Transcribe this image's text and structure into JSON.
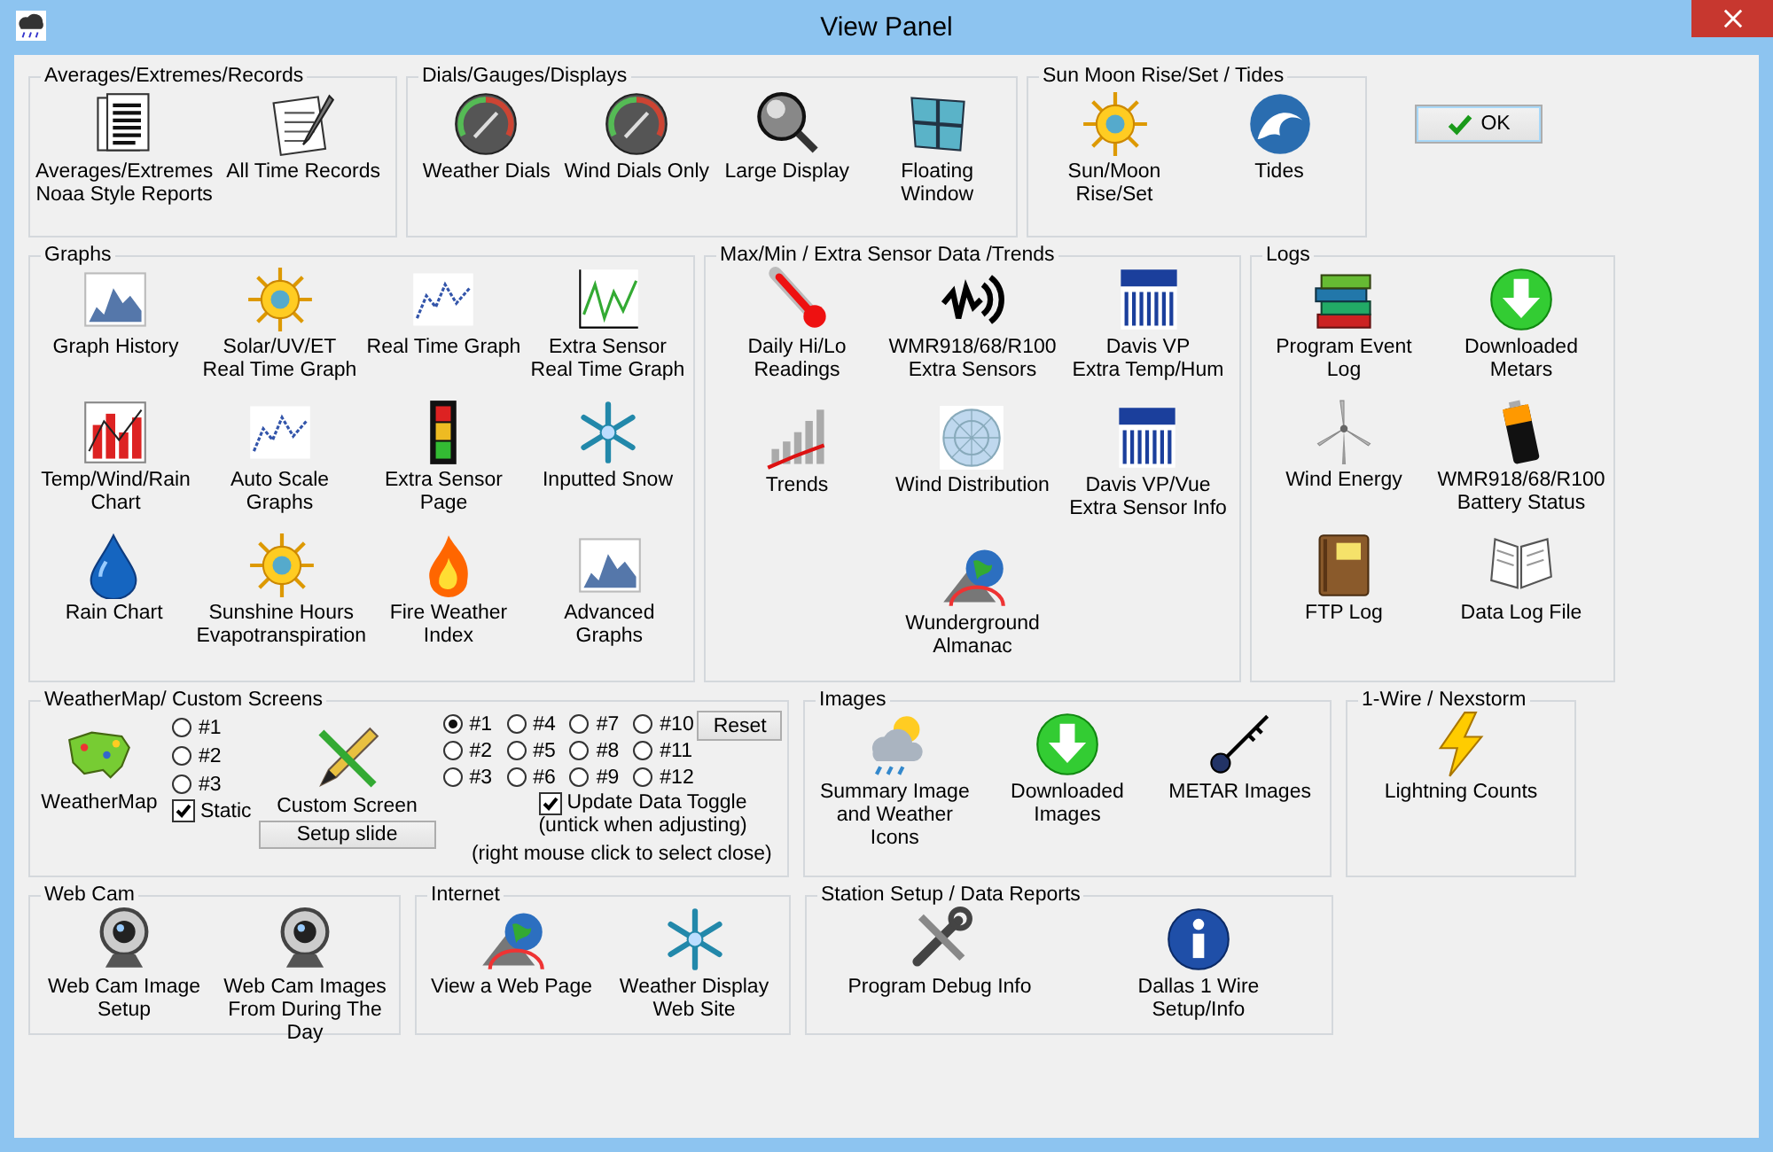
{
  "window": {
    "title": "View Panel"
  },
  "groups": [
    {
      "kind": "launchers",
      "title": "Averages/Extremes/Records",
      "rows": [
        [
          {
            "label": "Averages/Extremes\nNoaa Style Reports"
          },
          {
            "label": "All Time Records"
          }
        ]
      ]
    },
    {
      "kind": "launchers",
      "title": "Dials/Gauges/Displays",
      "rows": [
        [
          {
            "label": "Weather Dials"
          },
          {
            "label": "Wind Dials Only"
          },
          {
            "label": "Large Display"
          },
          {
            "label": "Floating Window"
          }
        ]
      ]
    },
    {
      "kind": "launchers",
      "title": "Sun Moon Rise/Set / Tides",
      "rows": [
        [
          {
            "label": "Sun/Moon\nRise/Set"
          },
          {
            "label": "Tides"
          }
        ]
      ]
    },
    {
      "kind": "launchers",
      "title": "Graphs",
      "rows": [
        [
          {
            "label": "Graph History"
          },
          {
            "label": "Solar/UV/ET\nReal Time Graph"
          },
          {
            "label": "Real Time Graph"
          },
          {
            "label": "Extra Sensor\nReal Time Graph"
          }
        ],
        [
          {
            "label": "Temp/Wind/Rain\nChart"
          },
          {
            "label": "Auto Scale Graphs"
          },
          {
            "label": "Extra Sensor\nPage"
          },
          {
            "label": "Inputted Snow"
          }
        ],
        [
          {
            "label": "Rain Chart"
          },
          {
            "label": "Sunshine Hours\nEvapotranspiration"
          },
          {
            "label": "Fire Weather Index"
          },
          {
            "label": "Advanced Graphs"
          }
        ]
      ]
    },
    {
      "kind": "launchers",
      "title": "Max/Min / Extra Sensor Data /Trends",
      "rows": [
        [
          {
            "label": "Daily Hi/Lo Readings"
          },
          {
            "label": "WMR918/68/R100\nExtra Sensors"
          },
          {
            "label": "Davis VP\nExtra Temp/Hum"
          }
        ],
        [
          {
            "label": "Trends"
          },
          {
            "label": "Wind Distribution"
          },
          {
            "label": "Davis VP/Vue\nExtra Sensor Info"
          }
        ],
        [
          null,
          {
            "label": "Wunderground\nAlmanac"
          },
          null
        ]
      ]
    },
    {
      "kind": "launchers",
      "title": "Logs",
      "rows": [
        [
          {
            "label": "Program Event Log"
          },
          {
            "label": "Downloaded\nMetars"
          }
        ],
        [
          {
            "label": "Wind Energy"
          },
          {
            "label": "WMR918/68/R100\nBattery Status"
          }
        ],
        [
          {
            "label": "FTP Log"
          },
          {
            "label": "Data Log File"
          }
        ]
      ]
    },
    {
      "kind": "custom_screens",
      "title": "WeatherMap/ Custom Screens",
      "map_item": {
        "label": "WeatherMap"
      },
      "map_radios": [
        {
          "label": "#1",
          "selected": false
        },
        {
          "label": "#2",
          "selected": false
        },
        {
          "label": "#3",
          "selected": false
        }
      ],
      "static_checkbox": {
        "label": "Static",
        "checked": true
      },
      "custom_item": {
        "label": "Custom Screen"
      },
      "setup_button": {
        "label": "Setup slide"
      },
      "screen_radios": [
        {
          "label": "#1",
          "selected": true
        },
        {
          "label": "#2",
          "selected": false
        },
        {
          "label": "#3",
          "selected": false
        },
        {
          "label": "#4",
          "selected": false
        },
        {
          "label": "#5",
          "selected": false
        },
        {
          "label": "#6",
          "selected": false
        },
        {
          "label": "#7",
          "selected": false
        },
        {
          "label": "#8",
          "selected": false
        },
        {
          "label": "#9",
          "selected": false
        },
        {
          "label": "#10",
          "selected": false
        },
        {
          "label": "#11",
          "selected": false
        },
        {
          "label": "#12",
          "selected": false
        }
      ],
      "reset_button": {
        "label": "Reset"
      },
      "update_checkbox": {
        "label": "Update Data Toggle",
        "checked": true
      },
      "update_note": "(untick when adjusting)",
      "close_note": "(right mouse click to select close)"
    },
    {
      "kind": "launchers",
      "title": "Images",
      "rows": [
        [
          {
            "label": "Summary Image\nand Weather Icons"
          },
          {
            "label": "Downloaded Images"
          },
          {
            "label": "METAR Images"
          }
        ]
      ]
    },
    {
      "kind": "launchers",
      "title": "1-Wire / Nexstorm",
      "rows": [
        [
          {
            "label": "Lightning Counts"
          }
        ]
      ]
    },
    {
      "kind": "launchers",
      "title": "Web Cam",
      "rows": [
        [
          {
            "label": "Web Cam Image\nSetup"
          },
          {
            "label": "Web Cam Images\nFrom During The Day"
          }
        ]
      ]
    },
    {
      "kind": "launchers",
      "title": "Internet",
      "rows": [
        [
          {
            "label": "View a Web Page"
          },
          {
            "label": "Weather Display\nWeb Site"
          }
        ]
      ]
    },
    {
      "kind": "launchers",
      "title": "Station Setup / Data Reports",
      "rows": [
        [
          {
            "label": "Program Debug Info"
          },
          {
            "label": "Dallas 1 Wire\nSetup/Info"
          }
        ]
      ]
    }
  ],
  "ok_button": {
    "label": "OK"
  }
}
